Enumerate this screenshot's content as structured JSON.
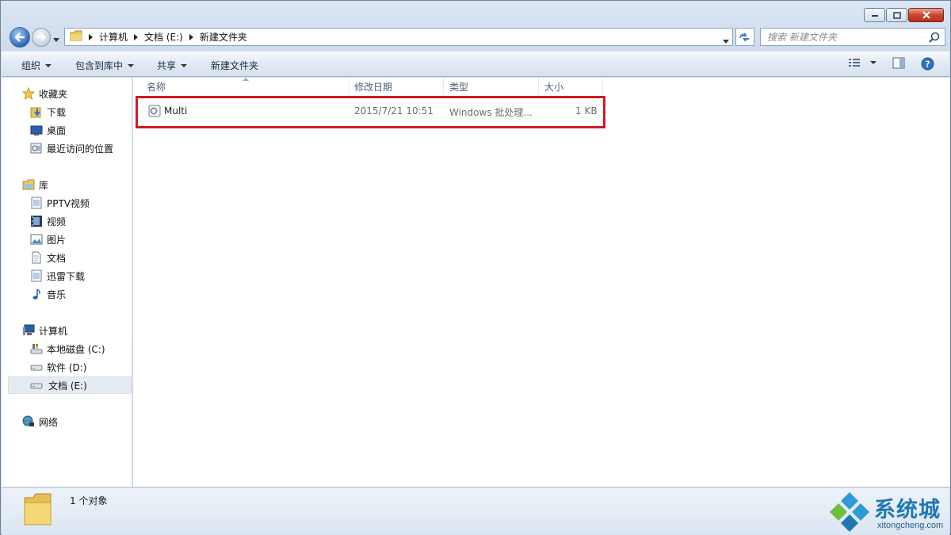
{
  "window": {
    "caption": {
      "minimize": "minimize",
      "maximize": "maximize",
      "close": "close"
    }
  },
  "address": {
    "crumbs": [
      "计算机",
      "文档 (E:)",
      "新建文件夹"
    ]
  },
  "search": {
    "placeholder": "搜索 新建文件夹"
  },
  "toolbar": {
    "organize": "组织",
    "include_in_library": "包含到库中",
    "share": "共享",
    "new_folder": "新建文件夹"
  },
  "sidebar": {
    "favorites": {
      "label": "收藏夹",
      "items": [
        "下载",
        "桌面",
        "最近访问的位置"
      ]
    },
    "libraries": {
      "label": "库",
      "items": [
        "PPTV视频",
        "视频",
        "图片",
        "文档",
        "迅雷下载",
        "音乐"
      ]
    },
    "computer": {
      "label": "计算机",
      "items": [
        "本地磁盘 (C:)",
        "软件 (D:)",
        "文档 (E:)"
      ]
    },
    "network": {
      "label": "网络"
    }
  },
  "columns": [
    "名称",
    "修改日期",
    "类型",
    "大小"
  ],
  "files": [
    {
      "name": "Multi",
      "modified": "2015/7/21 10:51",
      "type": "Windows 批处理...",
      "size": "1 KB"
    }
  ],
  "status": {
    "count": "1 个对象"
  },
  "watermark": {
    "name": "系统城",
    "url": "xitongcheng.com"
  },
  "colors": {
    "highlight": "#d11b22",
    "accent": "#2a67b8"
  }
}
